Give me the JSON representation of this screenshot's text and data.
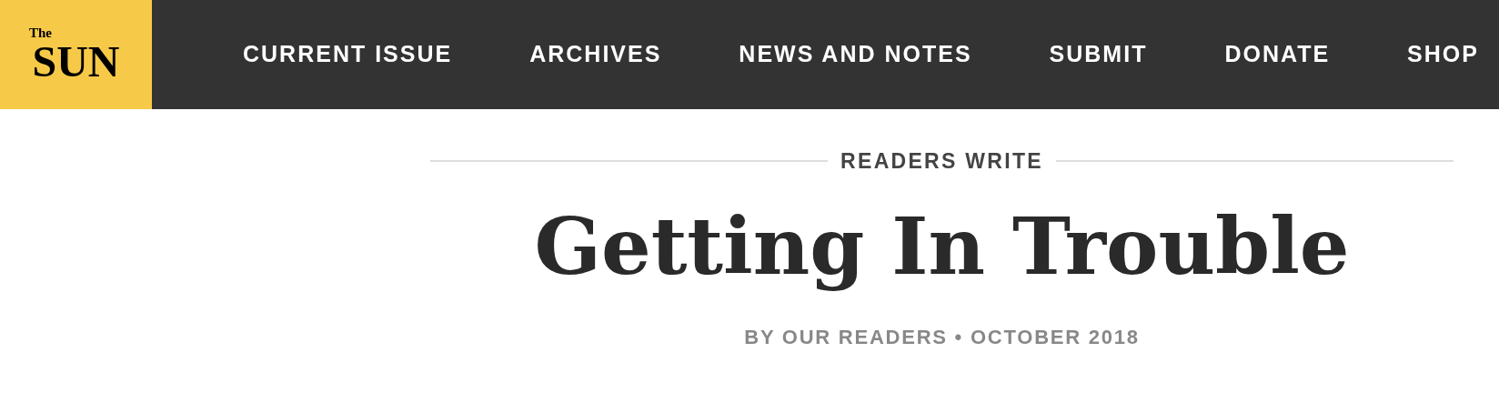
{
  "logo": {
    "small": "The",
    "large": "SUN"
  },
  "nav": [
    "CURRENT ISSUE",
    "ARCHIVES",
    "NEWS AND NOTES",
    "SUBMIT",
    "DONATE",
    "SHOP"
  ],
  "section_label": "READERS WRITE",
  "title": "Getting In Trouble",
  "byline": "BY OUR READERS • OCTOBER 2018"
}
